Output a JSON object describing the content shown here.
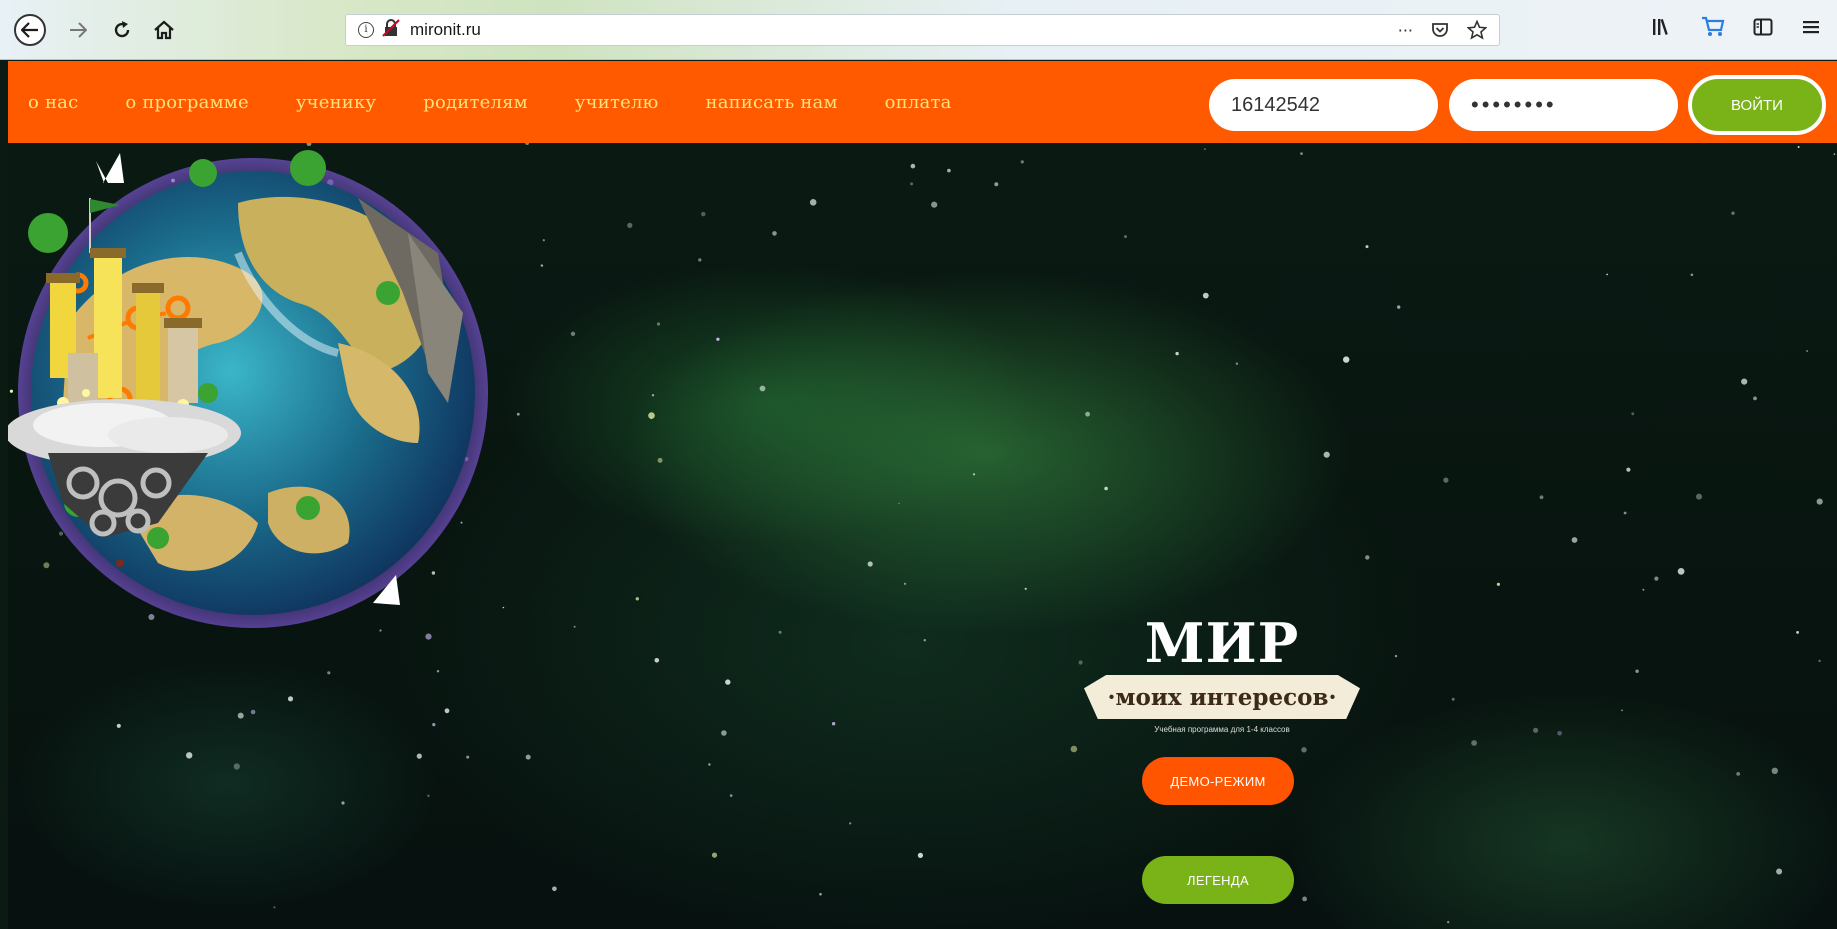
{
  "browser": {
    "url": "mironit.ru",
    "icons": [
      "back-icon",
      "forward-icon",
      "reload-icon",
      "home-icon",
      "info-icon",
      "insecure-lock-icon",
      "more-icon",
      "pocket-icon",
      "star-icon",
      "library-icon",
      "cart-icon",
      "sidebar-icon",
      "menu-icon"
    ],
    "more_glyph": "···"
  },
  "nav": {
    "links": [
      "о нас",
      "о программе",
      "ученику",
      "родителям",
      "учителю",
      "написать нам",
      "оплата"
    ],
    "login_value": "16142542",
    "password_value": "••••••••",
    "login_button": "ВОЙТИ"
  },
  "hero": {
    "logo_title": "МИР",
    "logo_subtitle": "·моих интересов·",
    "logo_caption": "Учебная программа для 1-4 классов",
    "demo_button": "ДЕМО-РЕЖИМ",
    "legend_button": "ЛЕГЕНДА"
  },
  "colors": {
    "accent_orange": "#ff5a00",
    "nav_link": "#ffe27a",
    "accent_green": "#7ab317"
  }
}
